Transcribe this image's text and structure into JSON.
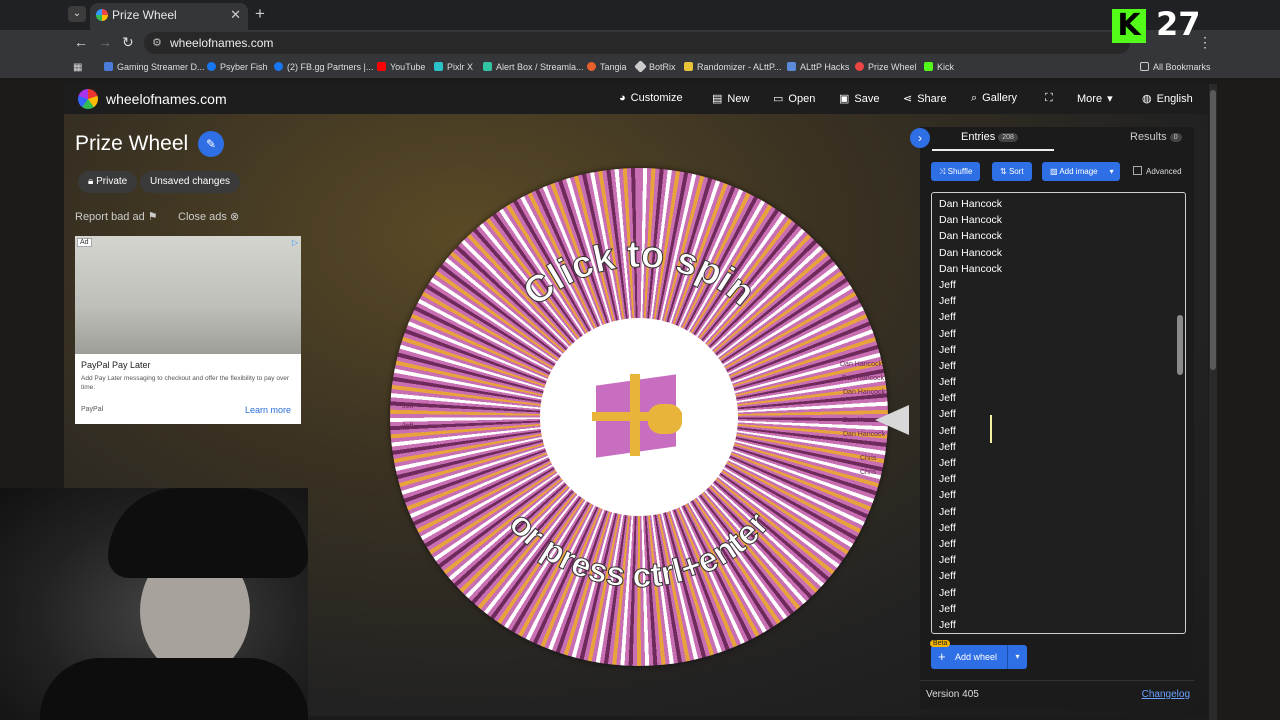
{
  "browser": {
    "tab_title": "Prize Wheel",
    "url": "wheelofnames.com",
    "bookmarks": [
      "Gaming Streamer D...",
      "Psyber Fish",
      "(2) FB.gg Partners |...",
      "YouTube",
      "Pixlr X",
      "Alert Box / Streamla...",
      "Tangia",
      "BotRix",
      "Randomizer - ALttP...",
      "ALttP Hacks",
      "Prize Wheel",
      "Kick"
    ],
    "all_bookmarks": "All Bookmarks"
  },
  "overlay": {
    "counter": "27"
  },
  "header": {
    "site": "wheelofnames.com",
    "menu": [
      "Customize",
      "New",
      "Open",
      "Save",
      "Share",
      "Gallery",
      "More",
      "English"
    ]
  },
  "wheel_page": {
    "title": "Prize Wheel",
    "chips": [
      "Private",
      "Unsaved changes"
    ],
    "report_ad": "Report bad ad",
    "close_ads": "Close ads",
    "spin_top": "Click to spin",
    "spin_bottom": "or press ctrl+enter",
    "slice_labels": [
      "Dan Hancock",
      "Jeff",
      "Chris"
    ]
  },
  "ad": {
    "tag": "Ad",
    "heading": "PayPal Pay Later",
    "description": "Add Pay Later messaging to checkout and offer the flexibility to pay over time.",
    "brand": "PayPal",
    "cta": "Learn more"
  },
  "panel": {
    "tab_entries": "Entries",
    "entries_count": "208",
    "tab_results": "Results",
    "results_count": "0",
    "shuffle": "Shuffle",
    "sort": "Sort",
    "add_image": "Add image",
    "advanced": "Advanced",
    "entries": [
      "Dan Hancock",
      "Dan Hancock",
      "Dan Hancock",
      "Dan Hancock",
      "Dan Hancock",
      "Jeff",
      "Jeff",
      "Jeff",
      "Jeff",
      "Jeff",
      "Jeff",
      "Jeff",
      "Jeff",
      "Jeff",
      "Jeff",
      "Jeff",
      "Jeff",
      "Jeff",
      "Jeff",
      "Jeff",
      "Jeff",
      "Jeff",
      "Jeff",
      "Jeff",
      "Jeff",
      "Jeff",
      "Jeff"
    ],
    "beta": "Beta",
    "add_wheel": "Add wheel",
    "version": "Version 405",
    "changelog": "Changelog"
  }
}
